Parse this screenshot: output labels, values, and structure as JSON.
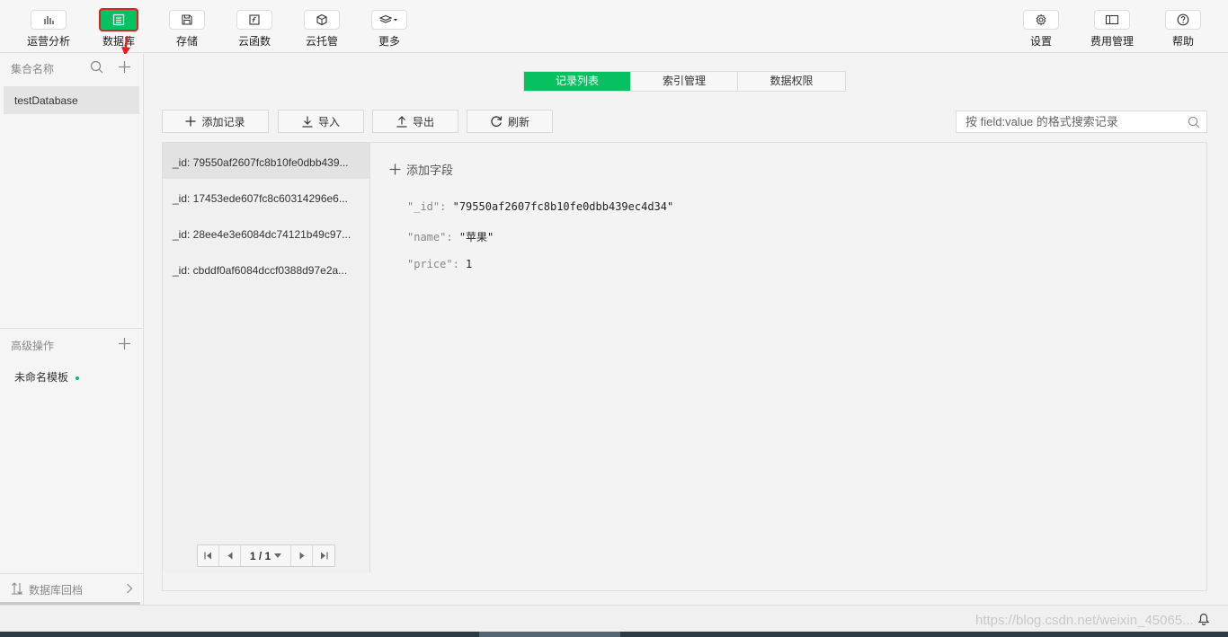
{
  "toolbar": {
    "items": [
      {
        "label": "运营分析",
        "icon": "bar-chart-icon"
      },
      {
        "label": "数据库",
        "icon": "database-icon"
      },
      {
        "label": "存储",
        "icon": "storage-icon"
      },
      {
        "label": "云函数",
        "icon": "function-icon"
      },
      {
        "label": "云托管",
        "icon": "container-icon"
      },
      {
        "label": "更多",
        "icon": "layers-icon"
      }
    ],
    "right_items": [
      {
        "label": "设置",
        "icon": "gear-icon"
      },
      {
        "label": "费用管理",
        "icon": "billing-icon"
      },
      {
        "label": "帮助",
        "icon": "help-icon"
      }
    ],
    "active": "数据库",
    "accent": "#07c160",
    "highlight": "#e02020"
  },
  "sidebar": {
    "collection_header": "集合名称",
    "collections": [
      "testDatabase"
    ],
    "advanced_header": "高级操作",
    "templates": [
      "未命名模板"
    ],
    "rollback_label": "数据库回档"
  },
  "tabs": [
    "记录列表",
    "索引管理",
    "数据权限"
  ],
  "active_tab": "记录列表",
  "actions": {
    "add_record": "添加记录",
    "import": "导入",
    "export": "导出",
    "refresh": "刷新"
  },
  "search": {
    "placeholder": "按 field:value 的格式搜索记录"
  },
  "records": [
    "_id: 79550af2607fc8b10fe0dbb439...",
    "_id: 17453ede607fc8c60314296e6...",
    "_id: 28ee4e3e6084dc74121b49c97...",
    "_id: cbddf0af6084dccf0388d97e2a..."
  ],
  "pagination": {
    "current": "1 / 1"
  },
  "detail": {
    "add_field_label": "添加字段",
    "fields": [
      {
        "key": "\"_id\":",
        "value": "\"79550af2607fc8b10fe0dbb439ec4d34\""
      },
      {
        "key": "\"name\":",
        "value": "\"苹果\""
      },
      {
        "key": "\"price\":",
        "value": "1"
      }
    ]
  },
  "status": {
    "watermark": "https://blog.csdn.net/weixin_45065..."
  }
}
